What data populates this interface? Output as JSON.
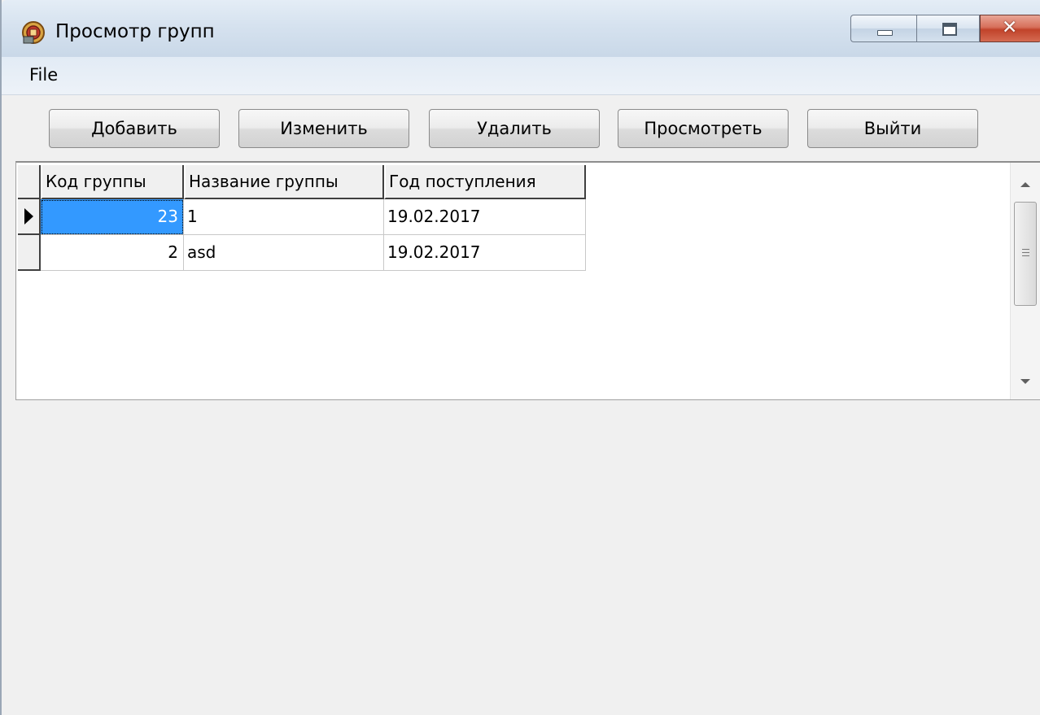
{
  "window": {
    "title": "Просмотр групп",
    "app_icon": "database-app-icon",
    "caption_buttons": [
      "minimize",
      "maximize",
      "close"
    ],
    "close_glyph": "✕"
  },
  "menubar": {
    "items": [
      {
        "label": "File"
      }
    ]
  },
  "toolbar": {
    "add_label": "Добавить",
    "edit_label": "Изменить",
    "delete_label": "Удалить",
    "view_label": "Просмотреть",
    "exit_label": "Выйти"
  },
  "grid": {
    "columns": [
      "Код группы",
      "Название группы",
      "Год поступления"
    ],
    "rows": [
      {
        "code": "23",
        "name": "1",
        "year": "19.02.2017",
        "current": true
      },
      {
        "code": "2",
        "name": "asd",
        "year": "19.02.2017",
        "current": false
      }
    ],
    "selected_color": "#3399ff"
  }
}
